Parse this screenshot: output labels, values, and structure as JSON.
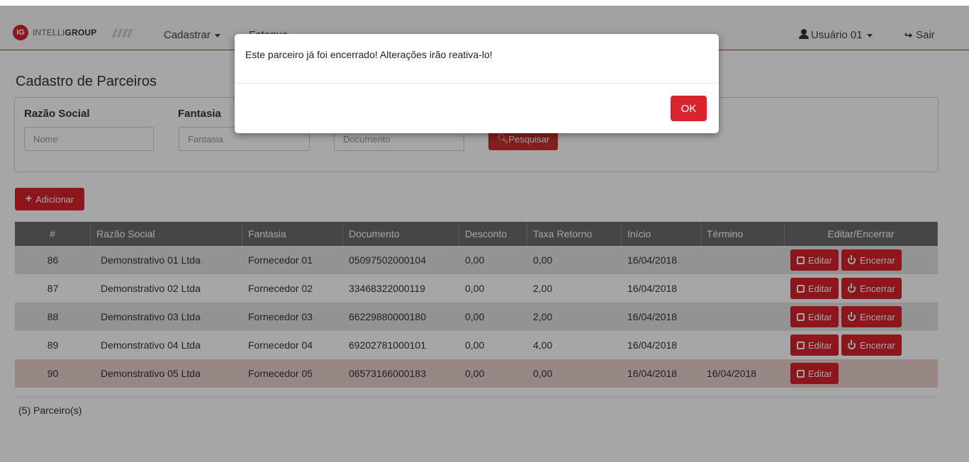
{
  "navbar": {
    "brand_badge": "IG",
    "brand_light": "INTELLI",
    "brand_bold": "GROUP",
    "menu": [
      {
        "label": "Cadastrar"
      },
      {
        "label": "Estoque"
      }
    ],
    "user_label": "Usuário 01",
    "logout_label": "Sair"
  },
  "page": {
    "title": "Cadastro de Parceiros",
    "filters": {
      "razao_label": "Razão Social",
      "razao_placeholder": "Nome",
      "fantasia_label": "Fantasia",
      "fantasia_placeholder": "Fantasia",
      "documento_placeholder": "Documento",
      "search_label": "Pesquisar"
    },
    "add_label": "Adicionar",
    "count_label": "(5) Parceiro(s)"
  },
  "table": {
    "headers": [
      "#",
      "Razão Social",
      "Fantasia",
      "Documento",
      "Desconto",
      "Taxa Retorno",
      "Início",
      "Término",
      "Editar/Encerrar"
    ],
    "edit_label": "Editar",
    "close_label": "Encerrar",
    "rows": [
      {
        "id": "86",
        "razao": "Demonstrativo 01 Ltda",
        "fantasia": "Fornecedor 01",
        "documento": "05097502000104",
        "desconto": "0,00",
        "taxa": "0,00",
        "inicio": "16/04/2018",
        "termino": ""
      },
      {
        "id": "87",
        "razao": "Demonstrativo 02 Ltda",
        "fantasia": "Fornecedor 02",
        "documento": "33468322000119",
        "desconto": "0,00",
        "taxa": "2,00",
        "inicio": "16/04/2018",
        "termino": ""
      },
      {
        "id": "88",
        "razao": "Demonstrativo 03 Ltda",
        "fantasia": "Fornecedor 03",
        "documento": "66229880000180",
        "desconto": "0,00",
        "taxa": "2,00",
        "inicio": "16/04/2018",
        "termino": ""
      },
      {
        "id": "89",
        "razao": "Demonstrativo 04 Ltda",
        "fantasia": "Fornecedor 04",
        "documento": "69202781000101",
        "desconto": "0,00",
        "taxa": "4,00",
        "inicio": "16/04/2018",
        "termino": ""
      },
      {
        "id": "90",
        "razao": "Demonstrativo 05 Ltda",
        "fantasia": "Fornecedor 05",
        "documento": "06573166000183",
        "desconto": "0,00",
        "taxa": "0,00",
        "inicio": "16/04/2018",
        "termino": "16/04/2018"
      }
    ]
  },
  "modal": {
    "message": "Este parceiro já foi encerrado! Alterações irão reativa-lo!",
    "ok_label": "OK"
  },
  "colors": {
    "accent": "#d9232d",
    "header_bg": "#6b6b6b",
    "closed_row": "#e8cfcf"
  }
}
